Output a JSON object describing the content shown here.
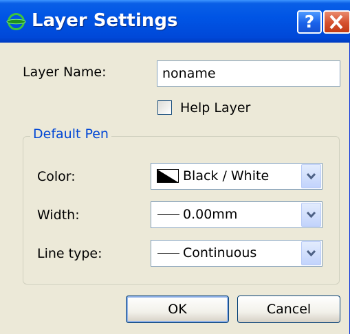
{
  "window": {
    "title": "Layer Settings",
    "help_glyph": "?",
    "close_icon": "close-icon",
    "app_icon": "layer-icon"
  },
  "form": {
    "layer_name_label": "Layer Name:",
    "layer_name_value": "noname",
    "help_layer_label": "Help Layer",
    "help_layer_checked": false
  },
  "default_pen": {
    "group_title": "Default Pen",
    "color_label": "Color:",
    "color_value": "Black / White",
    "width_label": "Width:",
    "width_value": "0.00mm",
    "line_type_label": "Line type:",
    "line_type_value": "Continuous"
  },
  "buttons": {
    "ok": "OK",
    "cancel": "Cancel"
  },
  "colors": {
    "titlebar": "#0055e5",
    "dialog_bg": "#ece9d8",
    "group_title": "#0046d5",
    "close_button": "#d5502e"
  }
}
